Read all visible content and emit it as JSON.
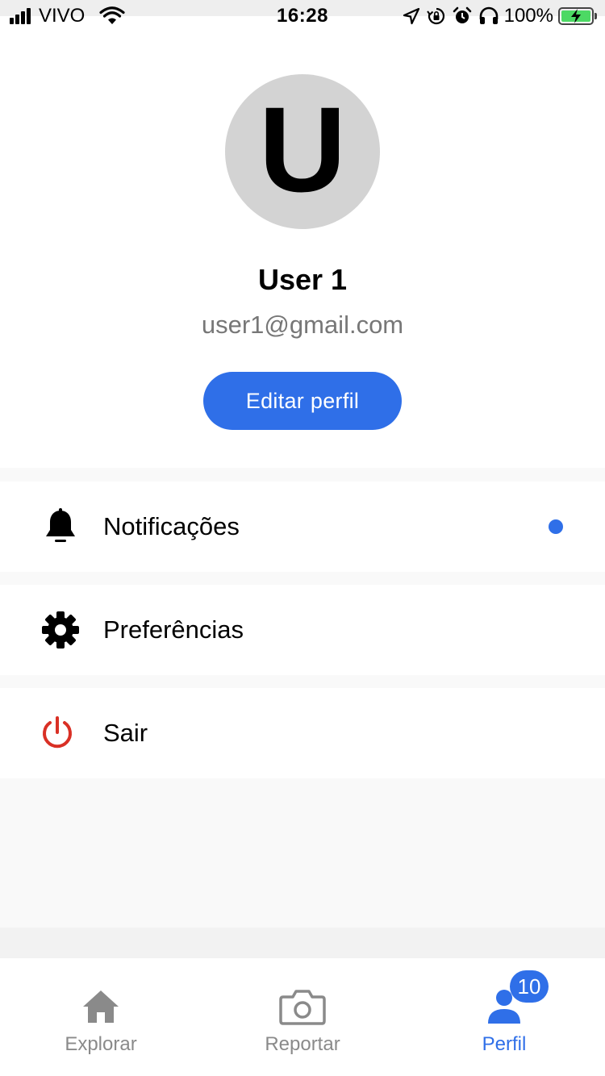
{
  "status_bar": {
    "carrier": "VIVO",
    "time": "16:28",
    "battery": "100%",
    "icons": [
      "signal-icon",
      "wifi-icon",
      "location-icon",
      "rotation-lock-icon",
      "alarm-icon",
      "headphones-icon",
      "battery-charging-icon"
    ]
  },
  "profile": {
    "avatar_letter": "U",
    "name": "User 1",
    "email": "user1@gmail.com",
    "edit_button_label": "Editar perfil"
  },
  "menu": {
    "items": [
      {
        "label": "Notificações",
        "icon": "bell-icon",
        "has_unread": true
      },
      {
        "label": "Preferências",
        "icon": "gear-icon"
      },
      {
        "label": "Sair",
        "icon": "power-icon"
      }
    ]
  },
  "tab_bar": {
    "tabs": [
      {
        "label": "Explorar",
        "icon": "home-icon",
        "active": false
      },
      {
        "label": "Reportar",
        "icon": "camera-icon",
        "active": false
      },
      {
        "label": "Perfil",
        "icon": "person-icon",
        "active": true,
        "badge": "10"
      }
    ]
  },
  "colors": {
    "accent": "#2f6fe8",
    "danger": "#d93025",
    "avatar_bg": "#d3d3d3",
    "inactive": "#8a8a8a",
    "battery_fill": "#4cd964"
  }
}
